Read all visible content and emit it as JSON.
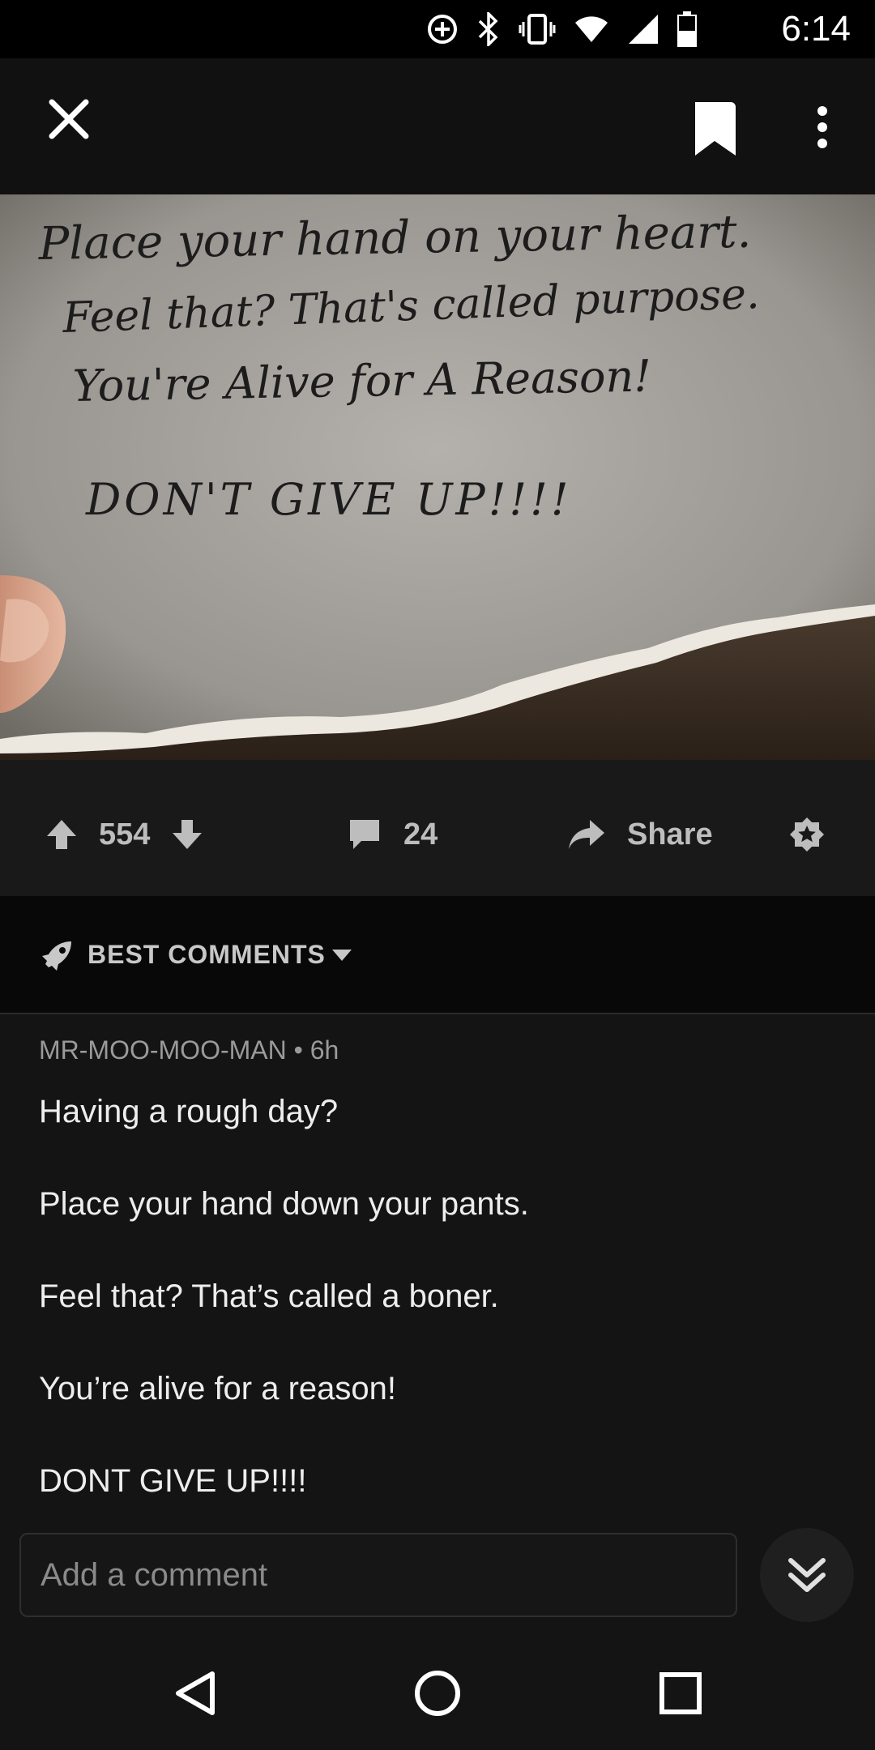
{
  "status_bar": {
    "time": "6:14",
    "icons": [
      "data-saver-icon",
      "bluetooth-icon",
      "vibrate-icon",
      "wifi-icon",
      "signal-icon",
      "battery-icon"
    ]
  },
  "header": {
    "icons": [
      "close-icon",
      "bookmark-icon",
      "more-vert-icon"
    ]
  },
  "post_image": {
    "handwriting_lines": [
      "Place your hand on your heart.",
      "Feel that? That's called purpose.",
      "You're Alive for A Reason!",
      "DON'T GIVE UP!!!!"
    ]
  },
  "actions": {
    "votes": "554",
    "comments": "24",
    "share_label": "Share"
  },
  "sort": {
    "label": "BEST COMMENTS"
  },
  "comment": {
    "author": "MR-MOO-MOO-MAN",
    "separator": " • ",
    "age": "6h",
    "lines": [
      "Having a rough day?",
      "Place your hand down your pants.",
      "Feel that?  That’s called a boner.",
      "You’re alive for a reason!",
      "DONT GIVE UP!!!!"
    ]
  },
  "composer": {
    "placeholder": "Add a comment"
  },
  "colors": {
    "background": "#141414",
    "action_bar": "#191919",
    "sort_bar": "#080808",
    "icon_gray": "#bdbdbd"
  }
}
